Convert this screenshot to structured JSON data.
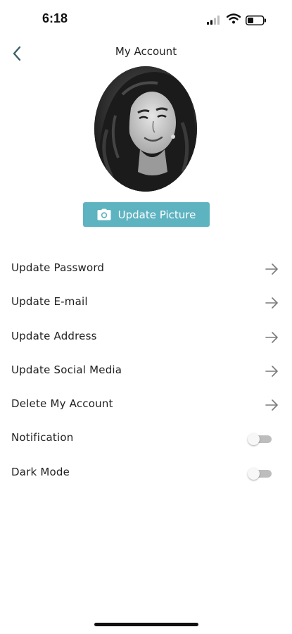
{
  "status_bar": {
    "time": "6:18"
  },
  "header": {
    "title": "My Account",
    "back_icon": "chevron-left-icon"
  },
  "profile": {
    "button_label": "Update Picture",
    "button_icon": "camera-icon",
    "accent_color": "#5eb3c1"
  },
  "menu": {
    "items": [
      {
        "label": "Update Password",
        "icon": "arrow-right-icon"
      },
      {
        "label": "Update E-mail",
        "icon": "arrow-right-icon"
      },
      {
        "label": "Update Address",
        "icon": "arrow-right-icon"
      },
      {
        "label": "Update Social Media",
        "icon": "arrow-right-icon"
      },
      {
        "label": "Delete My Account",
        "icon": "arrow-right-icon"
      }
    ],
    "toggles": [
      {
        "label": "Notification",
        "on": false
      },
      {
        "label": "Dark Mode",
        "on": false
      }
    ]
  }
}
